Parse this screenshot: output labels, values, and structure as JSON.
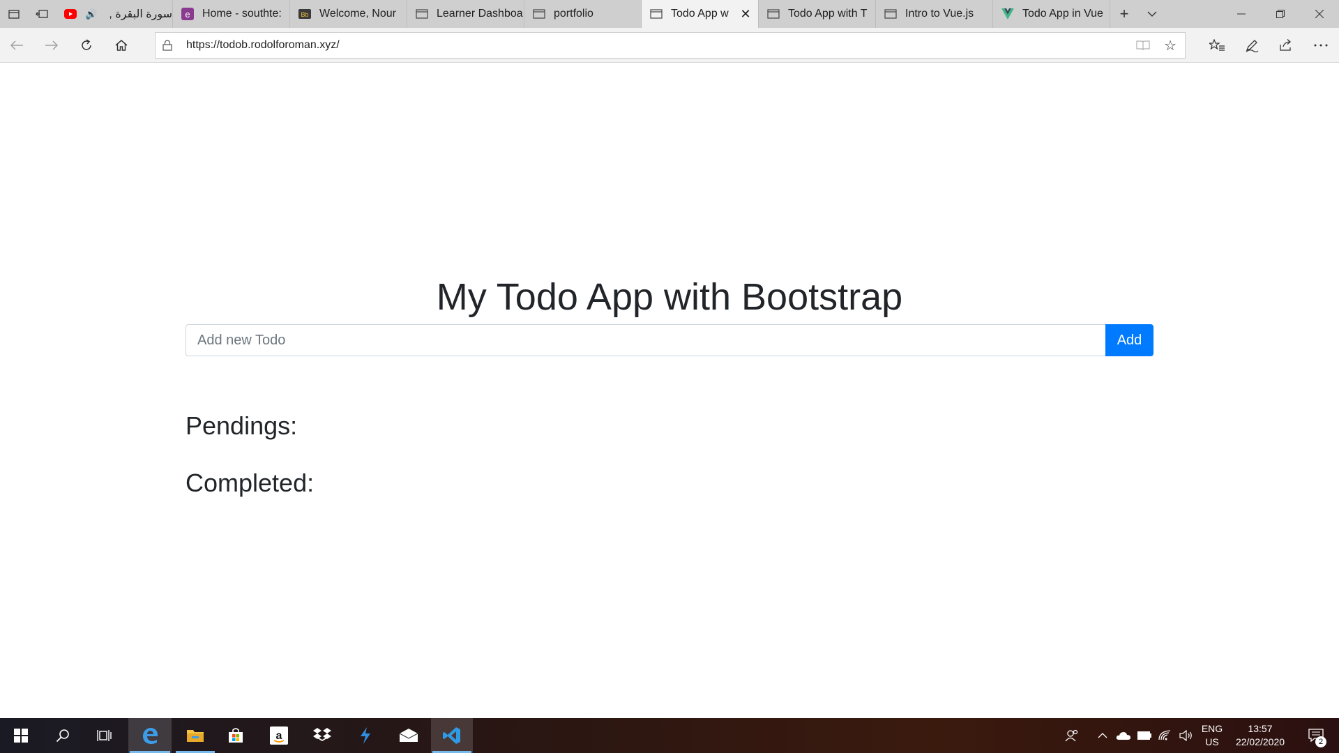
{
  "browser": {
    "tabs": [
      {
        "label": "سورة البقرة ,",
        "icon": "youtube-icon",
        "audio": true
      },
      {
        "label": "Home - southte:",
        "icon": "e-site-icon"
      },
      {
        "label": "Welcome, Nour",
        "icon": "bb-site-icon"
      },
      {
        "label": "Learner Dashboa",
        "icon": "page-icon"
      },
      {
        "label": "portfolio",
        "icon": "page-icon"
      },
      {
        "label": "Todo App w",
        "icon": "page-icon",
        "active": true
      },
      {
        "label": "Todo App with T",
        "icon": "page-icon"
      },
      {
        "label": "Intro to Vue.js",
        "icon": "page-icon"
      },
      {
        "label": "Todo App in Vue",
        "icon": "vue-icon"
      }
    ],
    "address": "https://todob.rodolforoman.xyz/"
  },
  "page": {
    "title": "My Todo App with Bootstrap",
    "input_placeholder": "Add new Todo",
    "add_label": "Add",
    "pending_heading": "Pendings:",
    "completed_heading": "Completed:"
  },
  "taskbar": {
    "language": "ENG",
    "region": "US",
    "time": "13:57",
    "date": "22/02/2020",
    "notification_count": "2"
  },
  "colors": {
    "primary": "#007bff",
    "tab_active": "#f2f2f2",
    "tab_strip": "#cfcfcf",
    "taskbar_active_indicator": "#76b9ed"
  }
}
